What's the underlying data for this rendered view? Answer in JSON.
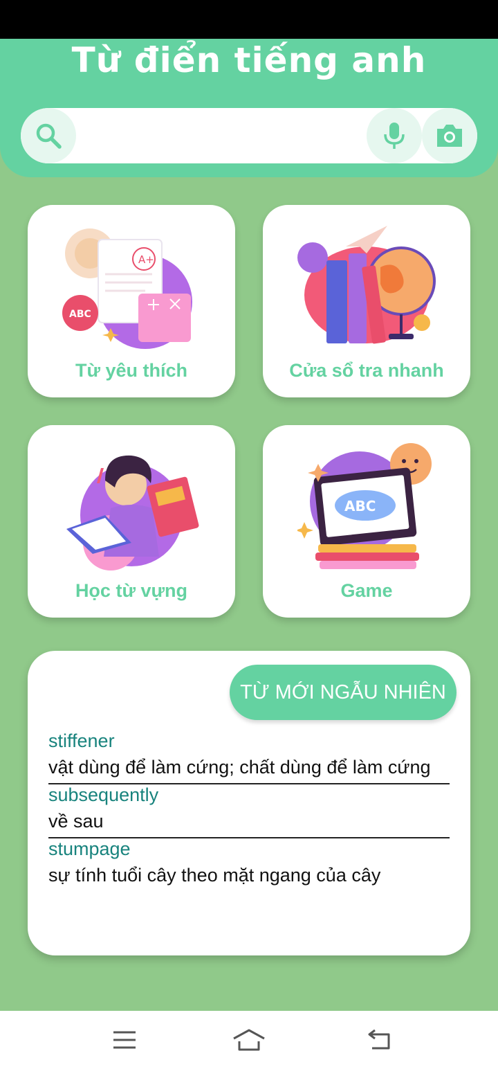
{
  "app": {
    "title": "Từ điển tiếng anh"
  },
  "search": {
    "value": "",
    "placeholder": ""
  },
  "icons": {
    "search": "search-icon",
    "mic": "microphone-icon",
    "camera": "camera-icon",
    "menu": "menu-icon",
    "home": "home-icon",
    "back": "back-icon"
  },
  "colors": {
    "accent": "#64d2a1",
    "background": "#90c98a",
    "term": "#18837d"
  },
  "features": [
    {
      "label": "Từ yêu thích"
    },
    {
      "label": "Cửa sổ tra nhanh"
    },
    {
      "label": "Học từ vựng"
    },
    {
      "label": "Game"
    }
  ],
  "random": {
    "button_label": "TỪ MỚI NGẪU NHIÊN",
    "words": [
      {
        "term": "stiffener",
        "meaning": "vật dùng để làm cứng; chất dùng để làm cứng"
      },
      {
        "term": "subsequently",
        "meaning": "về sau"
      },
      {
        "term": "stumpage",
        "meaning": "sự tính tuổi cây theo mặt ngang của cây"
      }
    ]
  }
}
